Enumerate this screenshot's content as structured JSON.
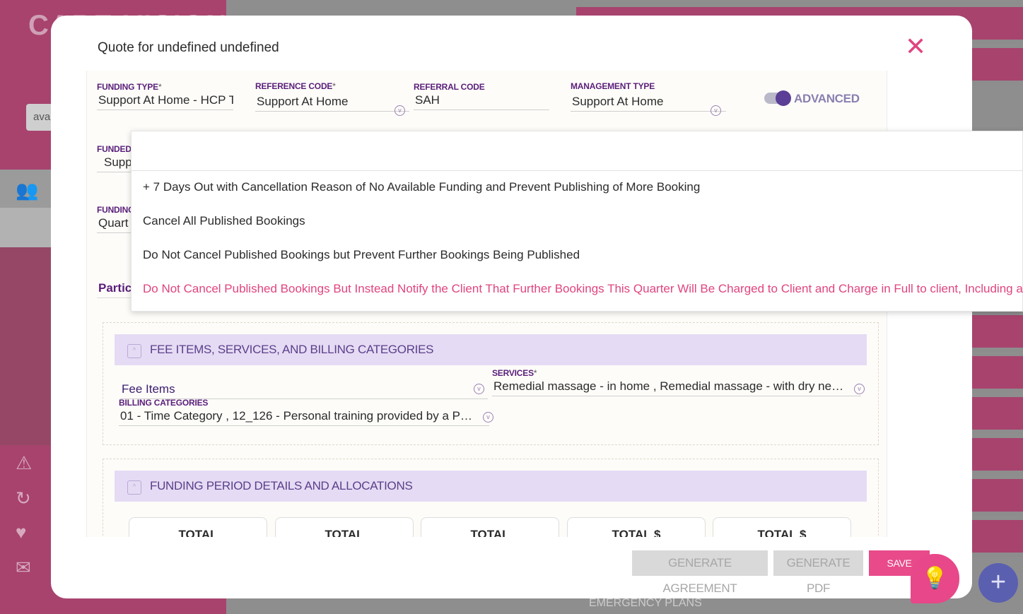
{
  "background": {
    "brand": "CARE VISION",
    "search_value": "ava",
    "right_panel_label": "EMERGENCY PLANS"
  },
  "modal": {
    "title": "Quote for undefined undefined"
  },
  "fields": {
    "funding_type": {
      "label": "FUNDING TYPE",
      "required": "*",
      "value": "Support At Home - HCP T"
    },
    "reference_code": {
      "label": "REFERENCE CODE",
      "required": "*",
      "value": "Support At Home"
    },
    "referral_code": {
      "label": "REFERRAL CODE",
      "value": "SAH"
    },
    "management_type": {
      "label": "MANAGEMENT TYPE",
      "value": "Support At Home"
    },
    "advanced_toggle": {
      "label": "ADVANCED",
      "state": "on"
    },
    "funded_by": {
      "label": "FUNDED",
      "value": "Supp"
    },
    "funding_period": {
      "label": "FUNDING",
      "value": "Quart"
    },
    "participant": {
      "label": "Partici"
    }
  },
  "dropdown": {
    "options": [
      "+ 7 Days Out with Cancellation Reason of No Available Funding and Prevent Publishing of More Booking",
      "Cancel All Published Bookings",
      "Do Not Cancel Published Bookings but Prevent Further Bookings Being Published",
      "Do Not Cancel Published Bookings But Instead Notify the Client That Further Bookings This Quarter Will Be Charged to Client and Charge in Full to client, Including a For"
    ],
    "selected_index": 3,
    "selected_color": "#e0447f"
  },
  "section_fees": {
    "title": "FEE ITEMS, SERVICES, AND BILLING CATEGORIES",
    "fee_items": {
      "value": "Fee Items"
    },
    "services": {
      "label": "SERVICES",
      "required": "*",
      "value": "Remedial massage - in home , Remedial massage - with dry needli..."
    },
    "billing_categories": {
      "label": "BILLING CATEGORIES",
      "value": "01 - Time Category , 12_126 - Personal training provided by a Pers..."
    }
  },
  "section_funding": {
    "title": "FUNDING PERIOD DETAILS AND ALLOCATIONS",
    "totals": [
      "TOTAL",
      "TOTAL",
      "TOTAL",
      "TOTAL $",
      "TOTAL $"
    ]
  },
  "footer": {
    "generate_agreement": "GENERATE AGREEMENT",
    "generate_pdf": "GENERATE PDF",
    "save": "SAVE"
  },
  "colors": {
    "accent_pink": "#e84a8a",
    "brand_purple": "#5a1e7a",
    "section_header_bg": "#e5dbf4"
  }
}
